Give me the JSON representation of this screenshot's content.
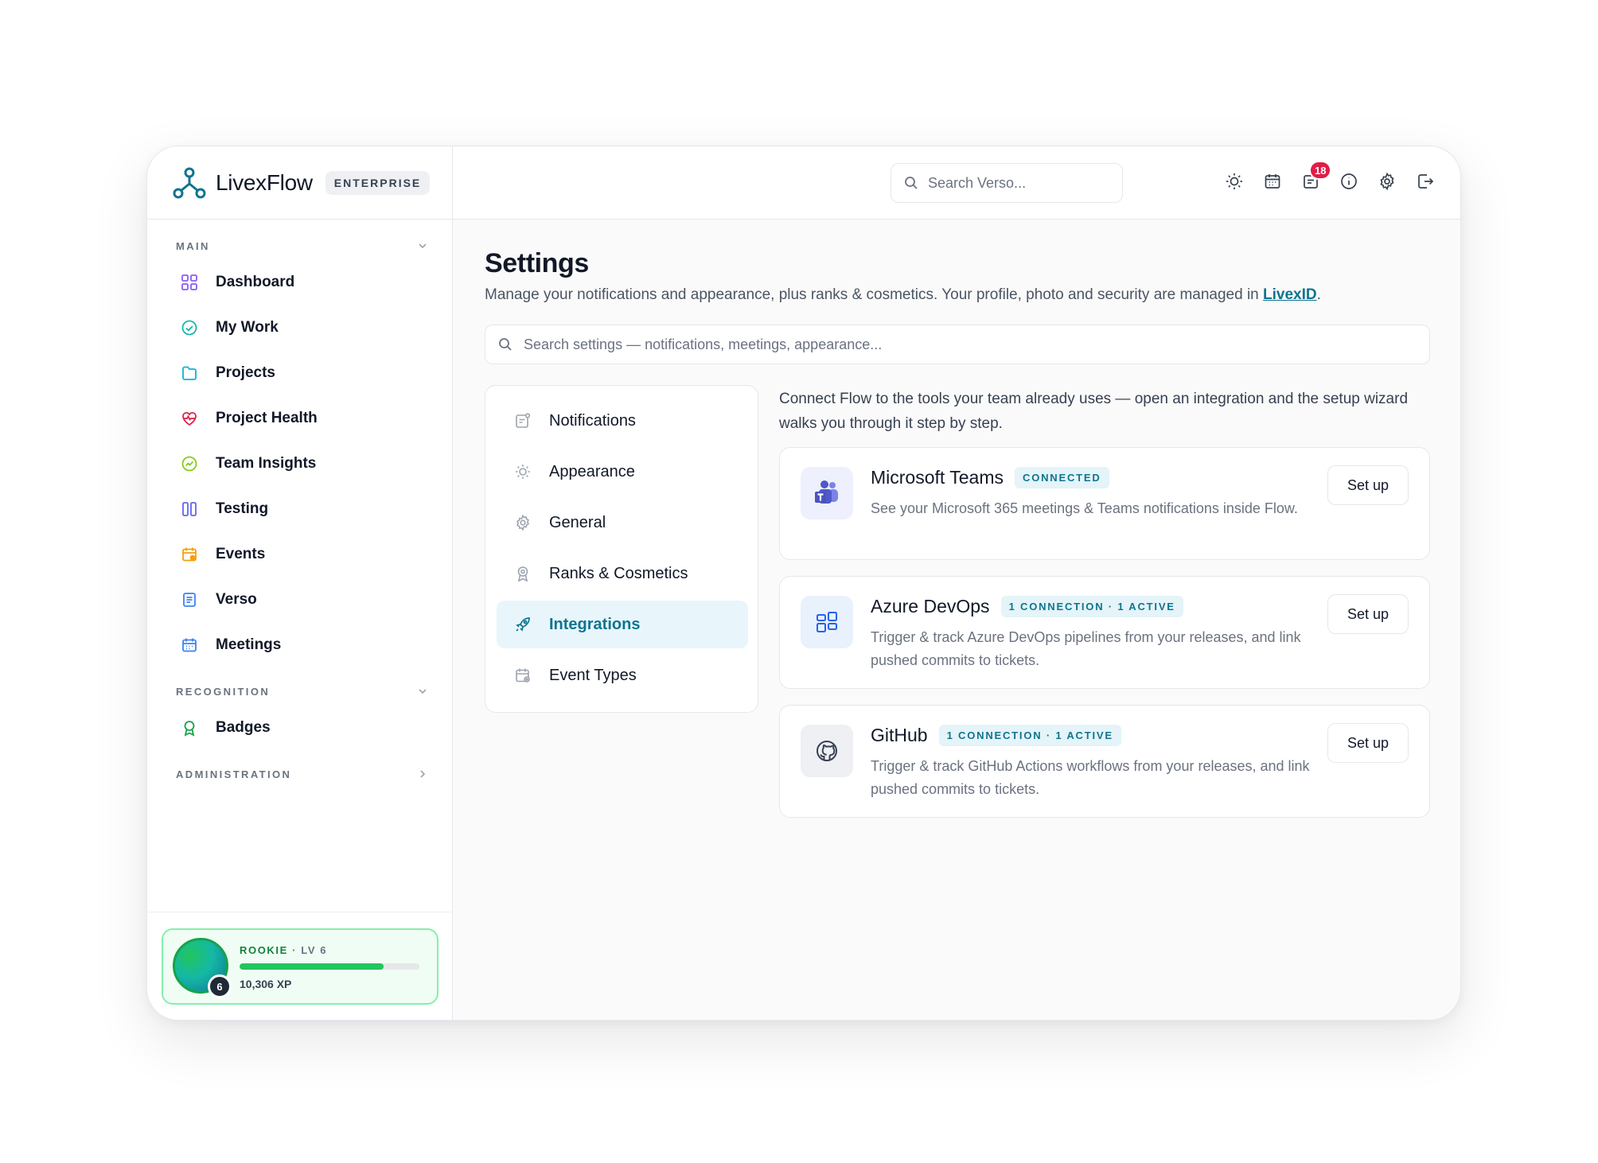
{
  "brand": {
    "name": "LivexFlow",
    "badge": "ENTERPRISE",
    "accent": "#0e7490"
  },
  "sidebar": {
    "sections": [
      {
        "label": "MAIN"
      },
      {
        "label": "RECOGNITION"
      },
      {
        "label": "ADMINISTRATION"
      }
    ],
    "main_items": [
      {
        "label": "Dashboard",
        "icon": "grid-icon"
      },
      {
        "label": "My Work",
        "icon": "check-circle-icon"
      },
      {
        "label": "Projects",
        "icon": "folder-icon"
      },
      {
        "label": "Project Health",
        "icon": "heart-pulse-icon"
      },
      {
        "label": "Team Insights",
        "icon": "chart-icon"
      },
      {
        "label": "Testing",
        "icon": "columns-icon"
      },
      {
        "label": "Events",
        "icon": "calendar-event-icon"
      },
      {
        "label": "Verso",
        "icon": "document-icon"
      },
      {
        "label": "Meetings",
        "icon": "calendar-icon"
      }
    ],
    "recognition_items": [
      {
        "label": "Badges",
        "icon": "award-icon"
      }
    ]
  },
  "user": {
    "rank": "ROOKIE",
    "level_label": "LV 6",
    "level": "6",
    "xp": "10,306 XP",
    "progress": 0.8
  },
  "topbar": {
    "search_placeholder": "Search Verso...",
    "notifications_count": "18"
  },
  "page": {
    "title": "Settings",
    "subtitle_prefix": "Manage your notifications and appearance, plus ranks & cosmetics. Your profile, photo and security are managed in ",
    "subtitle_link": "LivexID",
    "subtitle_suffix": ".",
    "search_placeholder": "Search settings — notifications, meetings, appearance..."
  },
  "settings_nav": [
    {
      "label": "Notifications",
      "icon": "notification-icon",
      "active": false
    },
    {
      "label": "Appearance",
      "icon": "sun-icon",
      "active": false
    },
    {
      "label": "General",
      "icon": "gear-icon",
      "active": false
    },
    {
      "label": "Ranks & Cosmetics",
      "icon": "medal-icon",
      "active": false
    },
    {
      "label": "Integrations",
      "icon": "rocket-icon",
      "active": true
    },
    {
      "label": "Event Types",
      "icon": "calendar-settings-icon",
      "active": false
    }
  ],
  "integrations": {
    "intro": "Connect Flow to the tools your team already uses — open an integration and the setup wizard walks you through it step by step.",
    "items": [
      {
        "name": "Microsoft Teams",
        "status": "CONNECTED",
        "description": "See your Microsoft 365 meetings & Teams notifications inside Flow.",
        "button": "Set up",
        "icon": "teams-icon"
      },
      {
        "name": "Azure DevOps",
        "status": "1 CONNECTION · 1 ACTIVE",
        "description": "Trigger & track Azure DevOps pipelines from your releases, and link pushed commits to tickets.",
        "button": "Set up",
        "icon": "azure-devops-icon"
      },
      {
        "name": "GitHub",
        "status": "1 CONNECTION · 1 ACTIVE",
        "description": "Trigger & track GitHub Actions workflows from your releases, and link pushed commits to tickets.",
        "button": "Set up",
        "icon": "github-icon"
      }
    ]
  }
}
